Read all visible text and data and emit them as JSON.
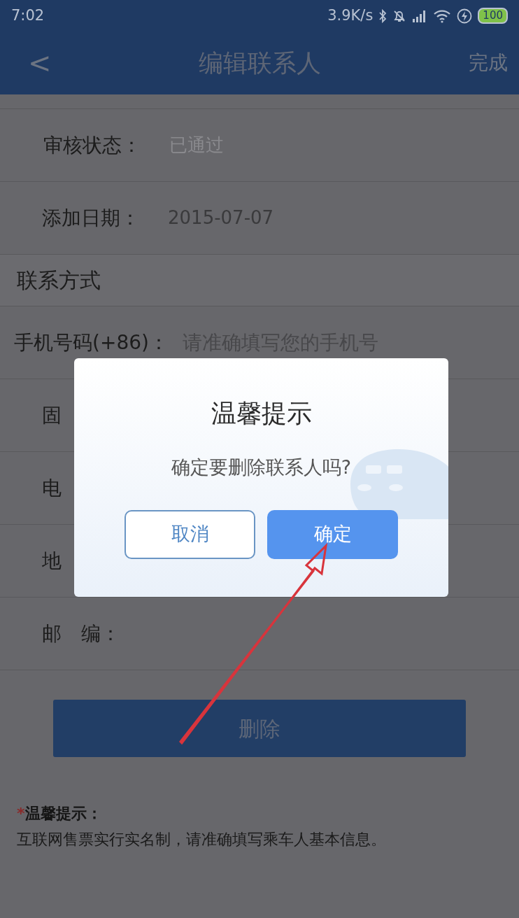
{
  "status_bar": {
    "time": "7:02",
    "speed": "3.9K/s",
    "battery": "100"
  },
  "header": {
    "back": "<",
    "title": "编辑联系人",
    "action": "完成"
  },
  "rows": [
    {
      "kind": "field",
      "label": "审核状态：",
      "value": "已通过",
      "muted": true
    },
    {
      "kind": "field",
      "label": "添加日期：",
      "value": "2015-07-07",
      "muted": false
    },
    {
      "kind": "section",
      "label": "联系方式"
    },
    {
      "kind": "field",
      "label": "手机号码(+86)：",
      "placeholder": "请准确填写您的手机号"
    },
    {
      "kind": "field",
      "label": "固"
    },
    {
      "kind": "field",
      "label": "电"
    },
    {
      "kind": "field",
      "label": "地"
    },
    {
      "kind": "field",
      "label": "邮　编："
    }
  ],
  "delete_button": "删除",
  "notice": {
    "mark": "*",
    "title": "温馨提示：",
    "text": "互联网售票实行实名制，请准确填写乘车人基本信息。"
  },
  "dialog": {
    "title": "温馨提示",
    "message": "确定要删除联系人吗?",
    "buttons": [
      {
        "label": "取消",
        "primary": false
      },
      {
        "label": "确定",
        "primary": true
      }
    ]
  }
}
